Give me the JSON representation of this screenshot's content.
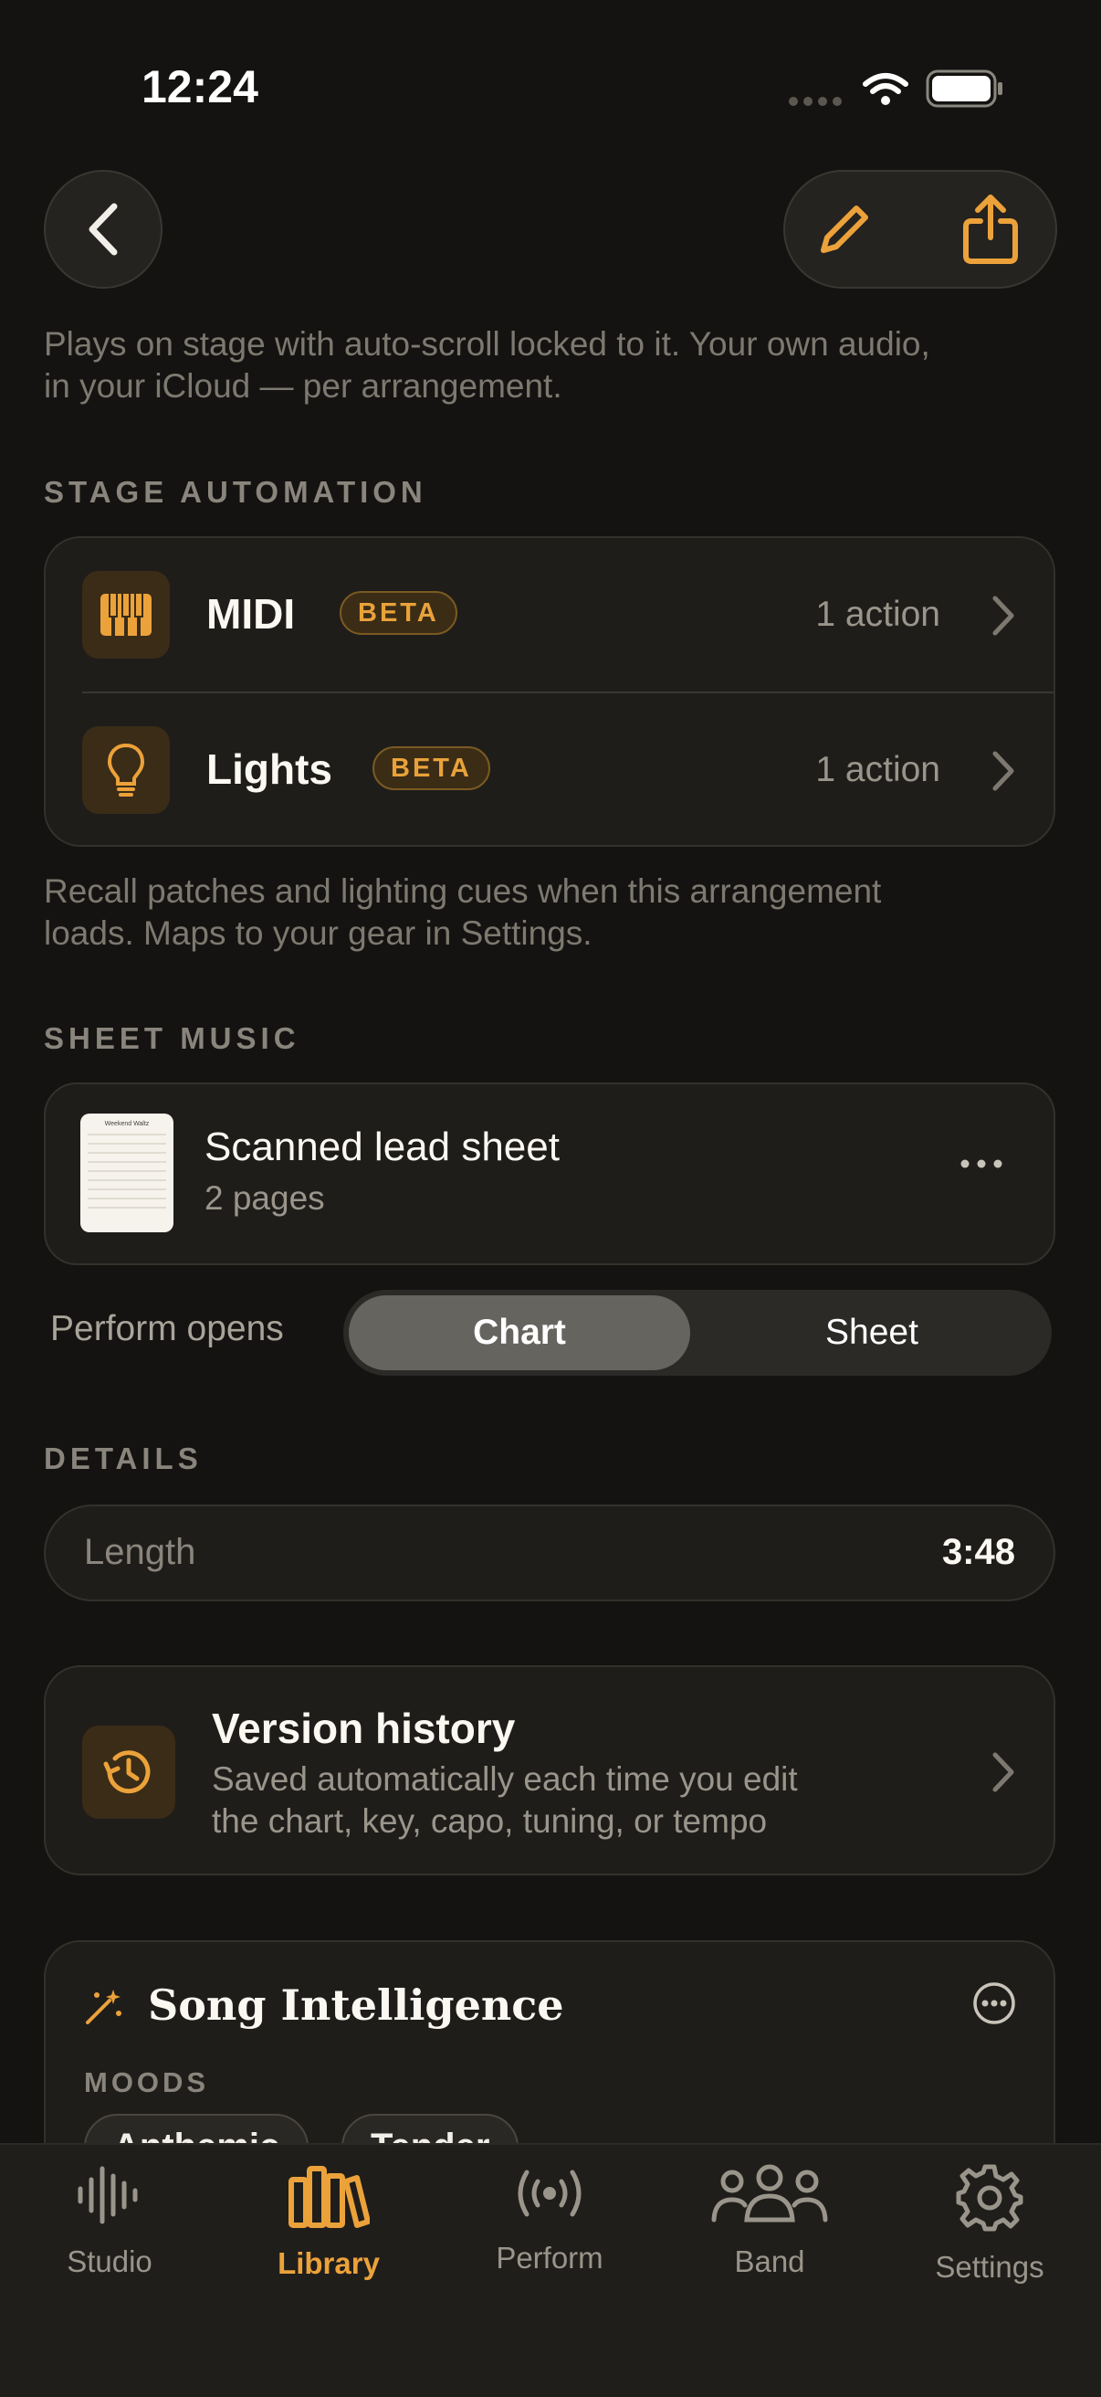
{
  "status_bar": {
    "time": "12:24"
  },
  "intro_text_line1": "Plays on stage with auto-scroll locked to it. Your own audio,",
  "intro_text_line2": "in your iCloud — per arrangement.",
  "stage_automation": {
    "header": "STAGE AUTOMATION",
    "rows": [
      {
        "title": "MIDI",
        "badge": "BETA",
        "meta": "1 action",
        "icon": "piano-keys-icon"
      },
      {
        "title": "Lights",
        "badge": "BETA",
        "meta": "1 action",
        "icon": "lightbulb-icon"
      }
    ],
    "footer_line1": "Recall patches and lighting cues when this arrangement",
    "footer_line2": "loads. Maps to your gear in Settings."
  },
  "sheet_music": {
    "header": "SHEET MUSIC",
    "title": "Scanned lead sheet",
    "subtitle": "2 pages",
    "thumbnail_title": "Weekend Waltz",
    "perform_opens_label": "Perform opens",
    "segments": [
      "Chart",
      "Sheet"
    ],
    "selected_segment": "Chart"
  },
  "details": {
    "header": "DETAILS",
    "length_label": "Length",
    "length_value": "3:48"
  },
  "version_history": {
    "title": "Version history",
    "desc_line1": "Saved automatically each time you edit",
    "desc_line2": "the chart, key, capo, tuning, or tempo"
  },
  "song_intelligence": {
    "title": "Song Intelligence",
    "moods_label": "MOODS",
    "moods": [
      "Anthemic",
      "Tender"
    ]
  },
  "tab_bar": {
    "tabs": [
      {
        "label": "Studio",
        "icon": "waveform-icon"
      },
      {
        "label": "Library",
        "icon": "library-books-icon"
      },
      {
        "label": "Perform",
        "icon": "broadcast-icon"
      },
      {
        "label": "Band",
        "icon": "people-icon"
      },
      {
        "label": "Settings",
        "icon": "gear-icon"
      }
    ],
    "active": "Library"
  },
  "colors": {
    "accent": "#eca23a",
    "background": "#141311",
    "card": "#1f1d1a",
    "badge_bg": "#3b2c15"
  }
}
